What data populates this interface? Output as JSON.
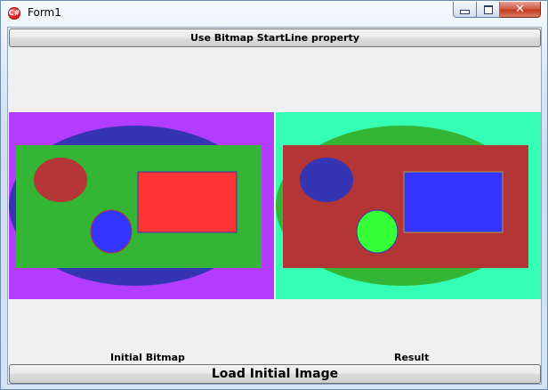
{
  "window": {
    "title": "Form1",
    "icon": "app-c-sharp-icon",
    "controls": {
      "minimize": "minimize-icon",
      "maximize": "maximize-icon",
      "close": "close-icon",
      "close_glyph": "✕"
    },
    "app_icon_glyph": "C#"
  },
  "buttons": {
    "startline_label": "Use Bitmap StartLine property",
    "load_label": "Load Initial Image"
  },
  "labels": {
    "initial": "Initial Bitmap",
    "result": "Result"
  },
  "images": {
    "initial": {
      "background": "#b23cff",
      "ellipse": "#3535b4",
      "panel": "#35b535",
      "small_ellipse": "#b33535",
      "rect": "#ff3535",
      "circle": "#3535ff"
    },
    "result": {
      "background": "#35ffb5",
      "ellipse": "#35b535",
      "panel": "#b33535",
      "small_ellipse": "#3535b4",
      "rect": "#3535ff",
      "circle": "#35ff35"
    }
  }
}
